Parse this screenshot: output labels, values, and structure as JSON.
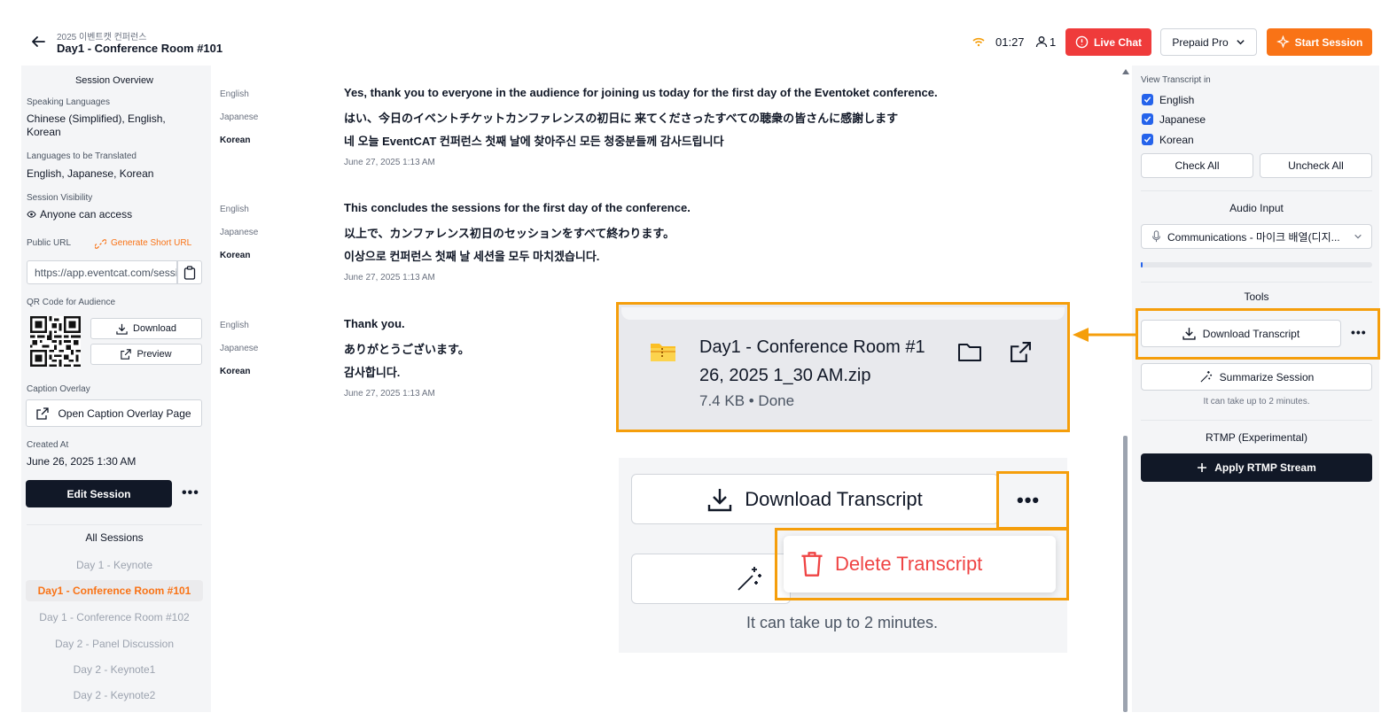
{
  "header": {
    "event_name": "2025 이벤트캣 컨퍼런스",
    "session_title": "Day1 - Conference Room #101",
    "timer": "01:27",
    "user_count": "1",
    "live_chat": "Live Chat",
    "plan": "Prepaid Pro",
    "start_session": "Start Session"
  },
  "sidebar": {
    "overview_title": "Session Overview",
    "speaking_label": "Speaking Languages",
    "speaking_value": "Chinese (Simplified), English, Korean",
    "translated_label": "Languages to be Translated",
    "translated_value": "English, Japanese, Korean",
    "visibility_label": "Session Visibility",
    "visibility_value": "Anyone can access",
    "public_url_label": "Public URL",
    "short_url_link": "Generate Short URL",
    "public_url_value": "https://app.eventcat.com/session",
    "qr_label": "QR Code for Audience",
    "qr_download": "Download",
    "qr_preview": "Preview",
    "caption_label": "Caption Overlay",
    "caption_button": "Open Caption Overlay Page",
    "created_label": "Created At",
    "created_value": "June 26, 2025 1:30 AM",
    "edit_button": "Edit Session",
    "more": "•••",
    "all_sessions_title": "All Sessions",
    "sessions": [
      {
        "label": "Day 1 - Keynote"
      },
      {
        "label": "Day1 - Conference Room #101"
      },
      {
        "label": "Day 1 - Conference Room #102"
      },
      {
        "label": "Day 2 - Panel Discussion"
      },
      {
        "label": "Day 2 - Keynote1"
      },
      {
        "label": "Day 2 - Keynote2"
      }
    ]
  },
  "transcript": {
    "blocks": [
      {
        "lines": [
          {
            "lang": "English",
            "text": "Yes, thank you to everyone in the audience for joining us today for the first day of the Eventoket conference."
          },
          {
            "lang": "Japanese",
            "text": "はい、今日のイベントチケットカンファレンスの初日に 来てくださったすべての聴衆の皆さんに感謝します"
          },
          {
            "lang": "Korean",
            "text": "네 오늘 EventCAT 컨퍼런스 첫째 날에 찾아주신 모든 청중분들께 감사드립니다"
          }
        ],
        "time": "June 27, 2025 1:13 AM"
      },
      {
        "lines": [
          {
            "lang": "English",
            "text": "This concludes the sessions for the first day of the conference."
          },
          {
            "lang": "Japanese",
            "text": "以上で、カンファレンス初日のセッションをすべて終わります。"
          },
          {
            "lang": "Korean",
            "text": "이상으로 컨퍼런스 첫째 날 세션을 모두 마치겠습니다."
          }
        ],
        "time": "June 27, 2025 1:13 AM"
      },
      {
        "lines": [
          {
            "lang": "English",
            "text": "Thank you."
          },
          {
            "lang": "Japanese",
            "text": "ありがとうございます。"
          },
          {
            "lang": "Korean",
            "text": "감사합니다."
          }
        ],
        "time": "June 27, 2025 1:13 AM"
      }
    ]
  },
  "right_panel": {
    "view_in_label": "View Transcript in",
    "languages": [
      {
        "label": "English",
        "checked": true
      },
      {
        "label": "Japanese",
        "checked": true
      },
      {
        "label": "Korean",
        "checked": true
      }
    ],
    "check_all": "Check All",
    "uncheck_all": "Uncheck All",
    "audio_title": "Audio Input",
    "audio_device": "Communications - 마이크 배열(디지...",
    "tools_title": "Tools",
    "download_transcript": "Download Transcript",
    "more": "•••",
    "summarize": "Summarize Session",
    "summarize_note": "It can take up to 2 minutes.",
    "rtmp_title": "RTMP (Experimental)",
    "apply_rtmp": "Apply RTMP Stream"
  },
  "callouts": {
    "file_name_line1": "Day1 - Conference Room #1",
    "file_name_line2": "26, 2025 1_30 AM.zip",
    "file_meta": "7.4 KB • Done",
    "big_download": "Download Transcript",
    "big_more": "•••",
    "delete": "Delete Transcript",
    "note": "It can take up to 2 minutes."
  },
  "colors": {
    "accent": "#f97316",
    "danger": "#ef3b3b",
    "callout": "#f59e0b",
    "check": "#2563eb",
    "dark": "#111827"
  }
}
